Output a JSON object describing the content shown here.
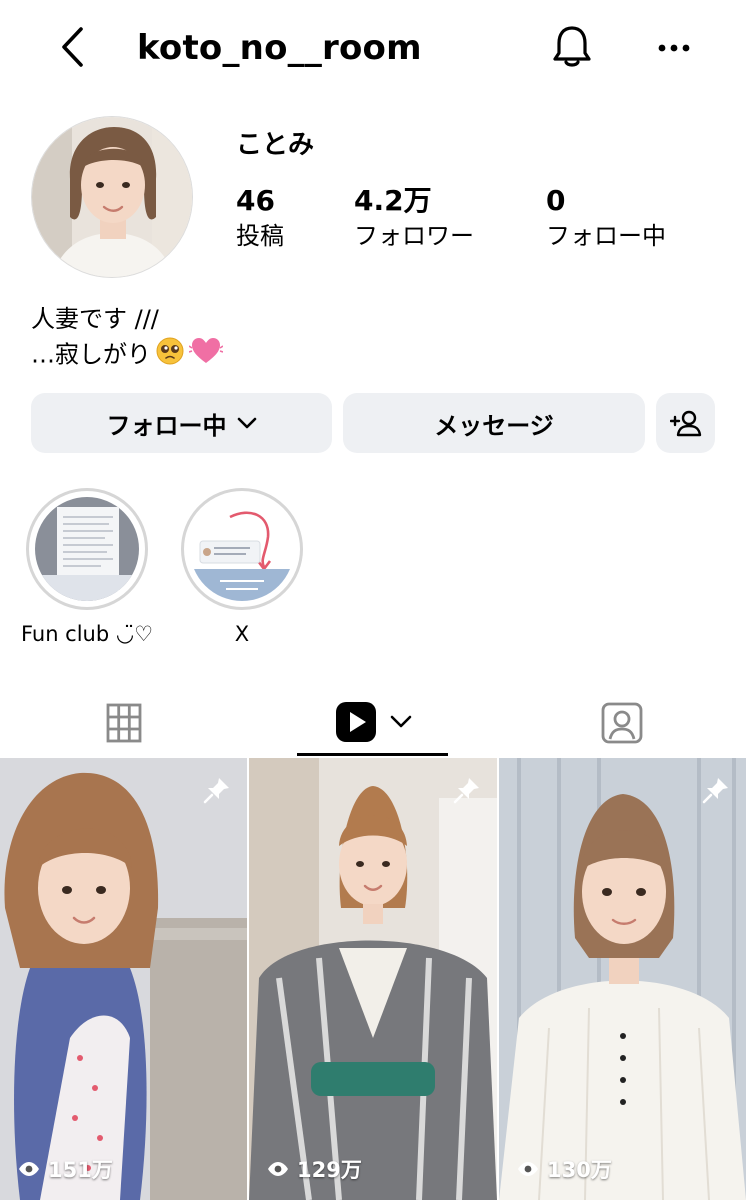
{
  "header": {
    "username": "koto_no__room",
    "back_icon": "chevron-left-icon",
    "bell_icon": "bell-icon",
    "more_icon": "more-horizontal-icon"
  },
  "profile": {
    "display_name": "ことみ",
    "stats": {
      "posts": {
        "value": "46",
        "label": "投稿"
      },
      "followers": {
        "value": "4.2万",
        "label": "フォロワー"
      },
      "following": {
        "value": "0",
        "label": "フォロー中"
      }
    },
    "bio": [
      "人妻です ///",
      "…寂しがり"
    ],
    "bio_emojis": [
      "pleading-face-emoji",
      "beating-heart-emoji"
    ]
  },
  "actions": {
    "follow_label": "フォロー中",
    "message_label": "メッセージ",
    "add_user_icon": "add-user-icon"
  },
  "highlights": [
    {
      "label": "Fun club ◡̈♡"
    },
    {
      "label": "X"
    }
  ],
  "tabs": {
    "active": "reels",
    "items": [
      "grid-icon",
      "reels-icon",
      "tagged-icon"
    ]
  },
  "reels": [
    {
      "views": "151万",
      "pinned": true
    },
    {
      "views": "129万",
      "pinned": true
    },
    {
      "views": "130万",
      "pinned": true
    }
  ],
  "colors": {
    "button_bg": "#eef0f3",
    "text": "#000000",
    "tab_icon": "#8a8a8a"
  }
}
